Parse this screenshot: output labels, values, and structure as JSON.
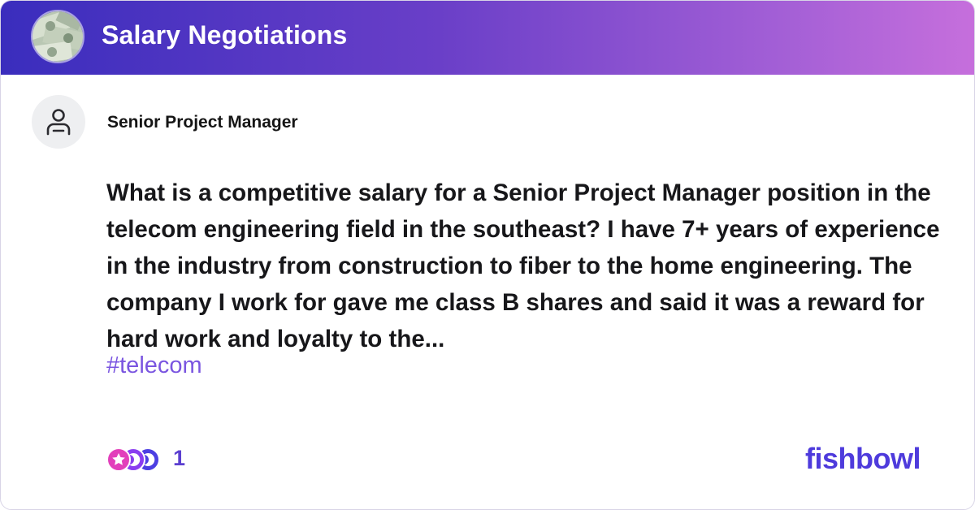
{
  "header": {
    "bowl_title": "Salary Negotiations",
    "bowl_avatar_icon": "money-bills-icon"
  },
  "post": {
    "author_avatar_icon": "user-icon",
    "author_title": "Senior Project Manager",
    "text": "What is a competitive salary for a Senior Project Manager position in the telecom engineering field in the southeast? I have 7+ years of experience in the industry from construction to fiber to the home engineering. The company I work for gave me class B shares and said it was a reward for hard work and loyalty to the...",
    "tag": "#telecom"
  },
  "footer": {
    "reaction_icons": [
      "reaction-icon-1",
      "reaction-icon-2",
      "reaction-icon-3"
    ],
    "reaction_count": "1",
    "brand": "fishbowl"
  },
  "colors": {
    "header_gradient_start": "#3a2dbd",
    "header_gradient_end": "#c66fdc",
    "accent": "#7a55e0",
    "brand": "#4e3bdc"
  }
}
